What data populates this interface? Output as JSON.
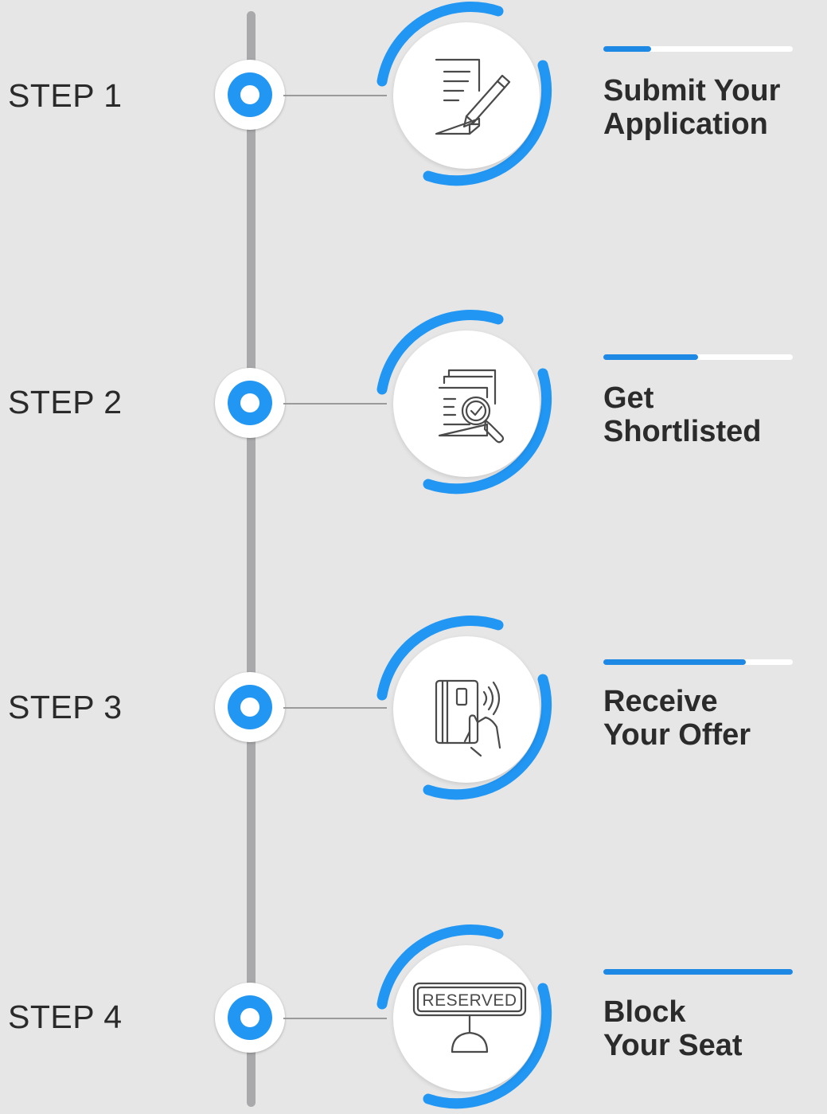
{
  "timeline": {
    "accent_color": "#2196f3",
    "line_color": "#a9a9ab",
    "steps": [
      {
        "label": "STEP 1",
        "title_line1": "Submit Your",
        "title_line2": "Application",
        "icon": "application-form-pen-icon",
        "progress": 0.25
      },
      {
        "label": "STEP 2",
        "title_line1": "Get",
        "title_line2": "Shortlisted",
        "icon": "document-magnifier-check-icon",
        "progress": 0.5
      },
      {
        "label": "STEP 3",
        "title_line1": "Receive",
        "title_line2": "Your Offer",
        "icon": "hand-card-contactless-icon",
        "progress": 0.75
      },
      {
        "label": "STEP 4",
        "title_line1": "Block",
        "title_line2": "Your Seat",
        "icon": "reserved-sign-icon",
        "icon_text": "RESERVED",
        "progress": 1.0
      }
    ]
  }
}
